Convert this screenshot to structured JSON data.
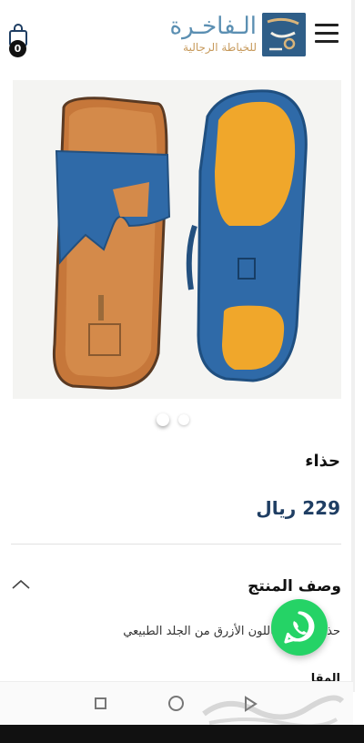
{
  "header": {
    "cart_count": "0",
    "logo_main": "الـفاخـرة",
    "logo_sub": "للخياطة الرجالية"
  },
  "product": {
    "title": "حذاء",
    "price": "229 ريال",
    "gallery_total": 2,
    "gallery_active": 1
  },
  "description": {
    "heading": "وصف المنتج",
    "text": "حذاء تايلندي باللون الأزرق من الجلد الطبيعي",
    "next_heading": "المقا"
  },
  "icons": {
    "cart": "shopping-bag-icon",
    "menu": "hamburger-menu-icon",
    "toggle": "chevron-up-icon",
    "whatsapp": "whatsapp-icon",
    "nav_recent": "square-icon",
    "nav_home": "circle-icon",
    "nav_back": "triangle-back-icon"
  },
  "colors": {
    "price": "#1f3e63",
    "whatsapp": "#25d366",
    "logo_blue": "#5b8fb2",
    "logo_gold": "#c79a5c"
  }
}
